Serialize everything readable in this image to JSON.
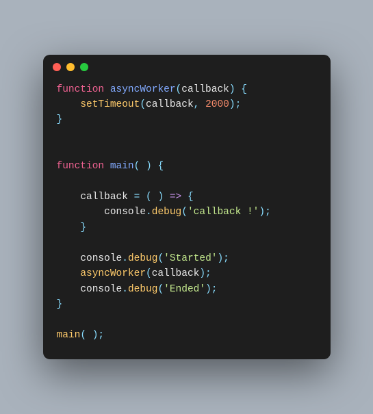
{
  "code": {
    "tokens": [
      [
        [
          "kw",
          "function "
        ],
        [
          "fn",
          "asyncWorker"
        ],
        [
          "punc",
          "("
        ],
        [
          "param",
          "callback"
        ],
        [
          "punc",
          ")"
        ],
        [
          "punc",
          " {"
        ]
      ],
      [
        [
          "",
          "    "
        ],
        [
          "name",
          "setTimeout"
        ],
        [
          "punc",
          "("
        ],
        [
          "param",
          "callback"
        ],
        [
          "punc",
          ", "
        ],
        [
          "num",
          "2000"
        ],
        [
          "punc",
          ");"
        ]
      ],
      [
        [
          "punc",
          "}"
        ]
      ],
      [
        [
          "",
          ""
        ]
      ],
      [
        [
          "",
          ""
        ]
      ],
      [
        [
          "kw",
          "function "
        ],
        [
          "fn",
          "main"
        ],
        [
          "punc",
          "( ) {"
        ]
      ],
      [
        [
          "",
          ""
        ]
      ],
      [
        [
          "",
          "    "
        ],
        [
          "param",
          "callback "
        ],
        [
          "punc",
          "= ( ) "
        ],
        [
          "arrow",
          "=>"
        ],
        [
          "punc",
          " {"
        ]
      ],
      [
        [
          "",
          "        "
        ],
        [
          "obj",
          "console"
        ],
        [
          "punc",
          "."
        ],
        [
          "name",
          "debug"
        ],
        [
          "punc",
          "("
        ],
        [
          "str",
          "'callback !'"
        ],
        [
          "punc",
          ");"
        ]
      ],
      [
        [
          "",
          "    "
        ],
        [
          "punc",
          "}"
        ]
      ],
      [
        [
          "",
          ""
        ]
      ],
      [
        [
          "",
          "    "
        ],
        [
          "obj",
          "console"
        ],
        [
          "punc",
          "."
        ],
        [
          "name",
          "debug"
        ],
        [
          "punc",
          "("
        ],
        [
          "str",
          "'Started'"
        ],
        [
          "punc",
          ");"
        ]
      ],
      [
        [
          "",
          "    "
        ],
        [
          "name",
          "asyncWorker"
        ],
        [
          "punc",
          "("
        ],
        [
          "param",
          "callback"
        ],
        [
          "punc",
          ");"
        ]
      ],
      [
        [
          "",
          "    "
        ],
        [
          "obj",
          "console"
        ],
        [
          "punc",
          "."
        ],
        [
          "name",
          "debug"
        ],
        [
          "punc",
          "("
        ],
        [
          "str",
          "'Ended'"
        ],
        [
          "punc",
          ");"
        ]
      ],
      [
        [
          "punc",
          "}"
        ]
      ],
      [
        [
          "",
          ""
        ]
      ],
      [
        [
          "name",
          "main"
        ],
        [
          "punc",
          "( );"
        ]
      ]
    ]
  },
  "chart_data": {
    "type": "table",
    "title": "JavaScript async callback example",
    "language": "javascript",
    "plain_text": "function asyncWorker(callback) {\n    setTimeout(callback, 2000);\n}\n\n\nfunction main( ) {\n\n    callback = ( ) => {\n        console.debug('callback !');\n    }\n\n    console.debug('Started');\n    asyncWorker(callback);\n    console.debug('Ended');\n}\n\nmain( );"
  }
}
